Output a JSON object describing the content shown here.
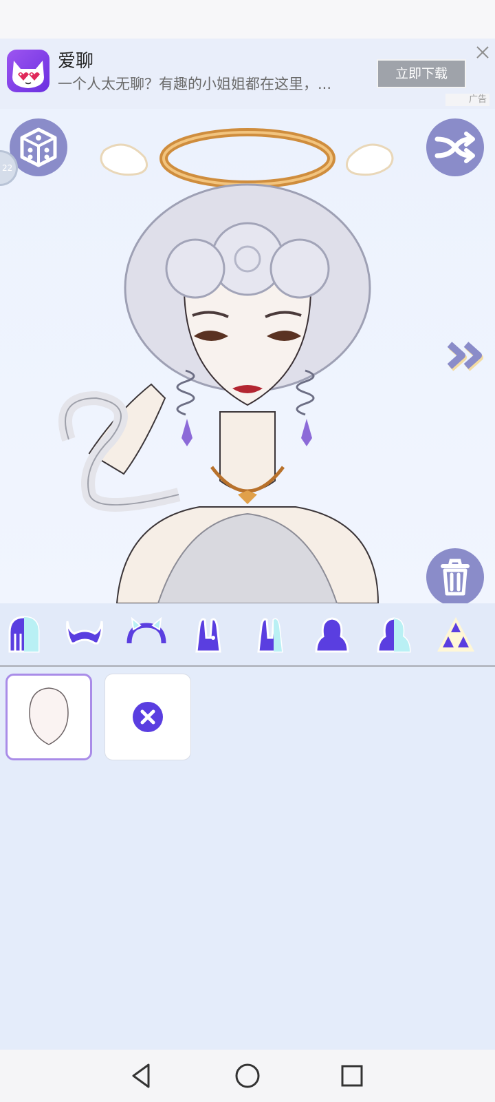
{
  "ad": {
    "app_name": "爱聊",
    "description": "一个人太无聊？有趣的小姐姐都在这里，...",
    "download_label": "立即下载",
    "ad_tag": "广告"
  },
  "canvas": {
    "buttons": [
      "dice-icon",
      "shuffle-icon",
      "next-icon",
      "trash-icon"
    ],
    "edge_badge_text": "22"
  },
  "categories": [
    {
      "name": "hair-back",
      "selected": true
    },
    {
      "name": "horns"
    },
    {
      "name": "headband-ears"
    },
    {
      "name": "bunny-ears"
    },
    {
      "name": "bunny-ears-alt"
    },
    {
      "name": "head-shape"
    },
    {
      "name": "face-shape"
    },
    {
      "name": "triangle-pattern"
    }
  ],
  "options": [
    {
      "name": "face-option-default",
      "selected": true
    },
    {
      "name": "remove-option"
    }
  ],
  "colors": {
    "accent": "#5a3ee0",
    "button_gray": "#8a8cc9",
    "selected_border": "#a98ce8"
  },
  "nav": [
    "back-icon",
    "home-icon",
    "recents-icon"
  ]
}
